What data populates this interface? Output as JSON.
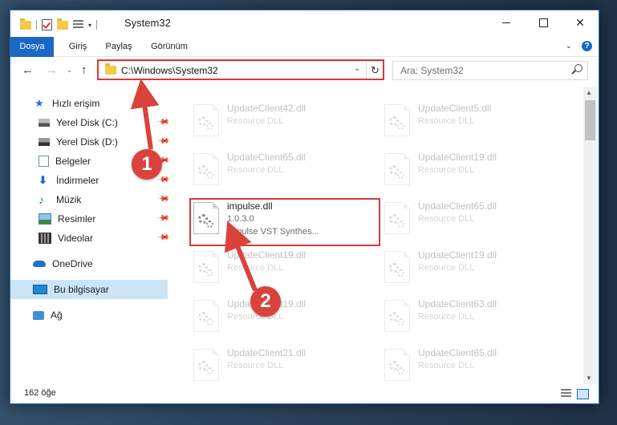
{
  "window": {
    "title": "System32"
  },
  "ribbon": {
    "tabs": [
      {
        "label": "Dosya",
        "active": true
      },
      {
        "label": "Giriş",
        "active": false
      },
      {
        "label": "Paylaş",
        "active": false
      },
      {
        "label": "Görünüm",
        "active": false
      }
    ],
    "help": "?"
  },
  "nav": {
    "address": "C:\\Windows\\System32",
    "search_placeholder": "Ara: System32"
  },
  "sidebar": {
    "quick_access": "Hızlı erişim",
    "items": [
      {
        "label": "Yerel Disk (C:)",
        "icon": "drive-icon",
        "pinned": true
      },
      {
        "label": "Yerel Disk (D:)",
        "icon": "drive-icon",
        "pinned": true
      },
      {
        "label": "Belgeler",
        "icon": "documents-icon",
        "pinned": true
      },
      {
        "label": "İndirmeler",
        "icon": "download-icon",
        "pinned": true
      },
      {
        "label": "Müzik",
        "icon": "music-icon",
        "pinned": true
      },
      {
        "label": "Resimler",
        "icon": "pictures-icon",
        "pinned": true
      },
      {
        "label": "Videolar",
        "icon": "videos-icon",
        "pinned": true
      }
    ],
    "onedrive": "OneDrive",
    "this_pc": "Bu bilgisayar",
    "network": "Ağ"
  },
  "files": {
    "col1": [
      {
        "name": "UpdateClient42.dll",
        "type": "Resource DLL"
      },
      {
        "name": "UpdateClient65.dll",
        "type": "Resource DLL"
      },
      {
        "name": "impulse.dll",
        "version": "1.0.3.0",
        "desc": "Impulse VST Synthes..."
      },
      {
        "name": "UpdateClient19.dll",
        "type": "Resource DLL"
      },
      {
        "name": "UpdateClient19.dll",
        "type": "Resource DLL"
      },
      {
        "name": "UpdateClient21.dll",
        "type": "Resource DLL"
      }
    ],
    "col2": [
      {
        "name": "UpdateClient5.dll",
        "type": "Resource DLL"
      },
      {
        "name": "UpdateClient19.dll",
        "type": "Resource DLL"
      },
      {
        "name": "UpdateClient65.dll",
        "type": "Resource DLL"
      },
      {
        "name": "UpdateClient19.dll",
        "type": "Resource DLL"
      },
      {
        "name": "UpdateClient63.dll",
        "type": "Resource DLL"
      },
      {
        "name": "UpdateClient65.dll",
        "type": "Resource DLL"
      }
    ]
  },
  "status": {
    "count": "162 öğe"
  },
  "annotations": {
    "step1": "1",
    "step2": "2",
    "color": "#d9433b"
  }
}
